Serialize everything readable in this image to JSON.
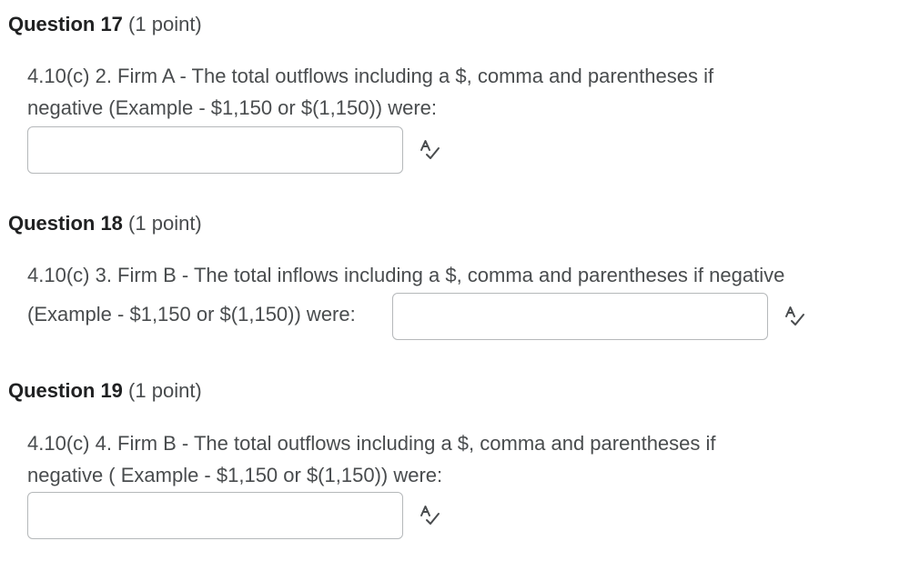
{
  "questions": [
    {
      "title": "Question 17",
      "points": "(1 point)",
      "line1": "4.10(c) 2. Firm A - The total outflows including a $, comma and parentheses if",
      "line2": "negative (Example - $1,150 or $(1,150)) were:",
      "answer_value": ""
    },
    {
      "title": "Question 18",
      "points": "(1 point)",
      "line1": "4.10(c) 3. Firm B - The total inflows including a $, comma and parentheses if negative",
      "line2": "(Example - $1,150 or $(1,150)) were:",
      "answer_value": ""
    },
    {
      "title": "Question 19",
      "points": "(1 point)",
      "line1": "4.10(c) 4. Firm B - The total outflows including a $, comma and parentheses if",
      "line2": "negative ( Example - $1,150 or $(1,150)) were:",
      "answer_value": ""
    }
  ],
  "icons": {
    "spellcheck": "spellcheck-icon"
  }
}
